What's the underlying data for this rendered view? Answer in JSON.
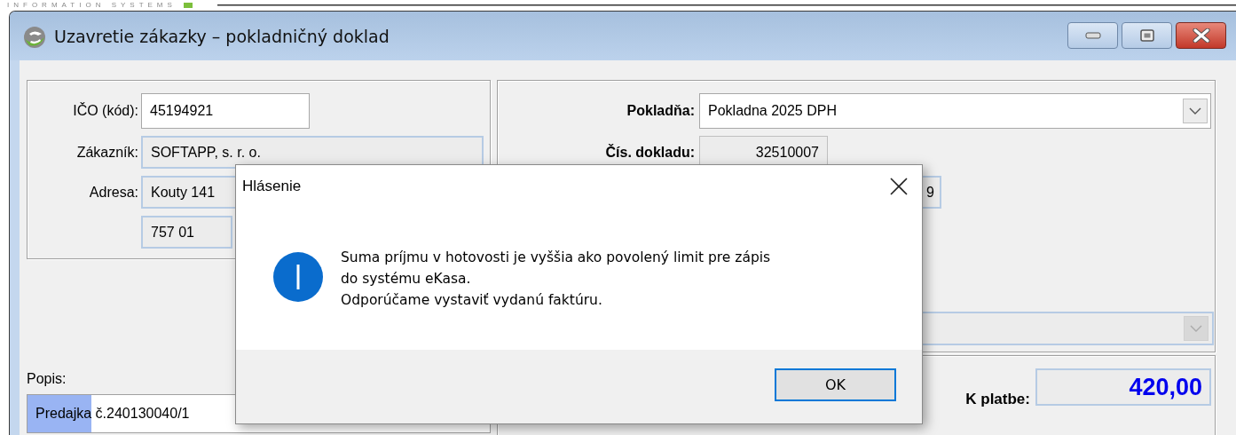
{
  "brand_strip": {
    "text": "INFORMATION SYSTEMS"
  },
  "window": {
    "title": "Uzavretie zákazky – pokladničný doklad"
  },
  "customer": {
    "fields": [
      {
        "label": "IČO (kód):",
        "value": "45194921",
        "kind": "editable"
      },
      {
        "label": "Zákazník:",
        "value": "SOFTAPP, s. r. o.",
        "kind": "readonly"
      },
      {
        "label": "Adresa:",
        "value": "Kouty 141",
        "kind": "readonly"
      },
      {
        "value": "757 01",
        "kind": "short"
      }
    ]
  },
  "description": {
    "label": "Popis:",
    "value_selected": "Predajka",
    "value_rest": " č.240130040/1"
  },
  "register": {
    "fields": [
      {
        "label": "Pokladňa:",
        "value": "Pokladna 2025 DPH",
        "kind": "combo"
      },
      {
        "label": "Čís. dokladu:",
        "value": "32510007",
        "kind": "number"
      },
      {
        "value": "9",
        "kind": "partial"
      }
    ],
    "second_combo": {
      "disabled": true
    }
  },
  "payment": {
    "label": "K platbe:",
    "value": "420,00"
  },
  "dialog": {
    "title": "Hlásenie",
    "message_lines": [
      "Suma príjmu v hotovosti je vyššia ako povolený limit pre zápis",
      "do systému eKasa.",
      "Odporúčame vystaviť vydanú faktúru."
    ],
    "buttons": [
      {
        "label": "OK",
        "default": true
      }
    ]
  }
}
